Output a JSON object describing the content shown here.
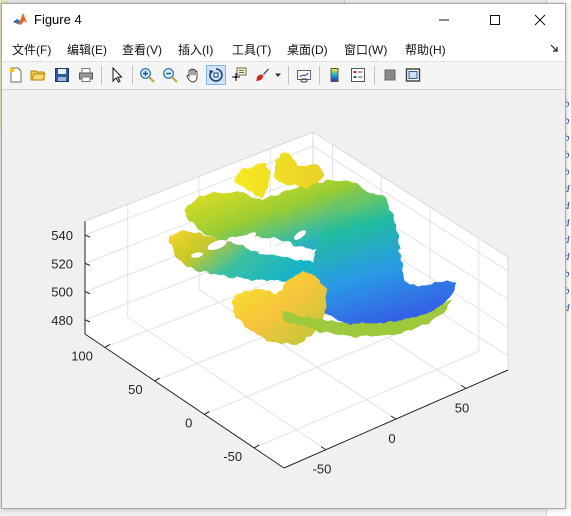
{
  "window": {
    "title": "Figure 4",
    "controls": {
      "minimize": "—",
      "maximize": "☐",
      "close": "✕"
    }
  },
  "menu": [
    {
      "label": "文件(F)"
    },
    {
      "label": "编辑(E)"
    },
    {
      "label": "查看(V)"
    },
    {
      "label": "插入(I)"
    },
    {
      "label": "工具(T)"
    },
    {
      "label": "桌面(D)"
    },
    {
      "label": "窗口(W)"
    },
    {
      "label": "帮助(H)"
    }
  ],
  "toolbar": [
    {
      "icon": "new-figure-icon"
    },
    {
      "icon": "open-file-icon"
    },
    {
      "icon": "save-icon"
    },
    {
      "icon": "print-icon"
    },
    {
      "icon": "edit-plot-arrow-icon"
    },
    {
      "icon": "zoom-in-icon"
    },
    {
      "icon": "zoom-out-icon"
    },
    {
      "icon": "pan-hand-icon"
    },
    {
      "icon": "rotate-3d-icon",
      "active": true
    },
    {
      "icon": "data-cursor-icon"
    },
    {
      "icon": "brush-icon"
    },
    {
      "icon": "link-plot-icon"
    },
    {
      "icon": "colorbar-icon"
    },
    {
      "icon": "legend-icon"
    },
    {
      "icon": "hide-plot-tools-icon"
    },
    {
      "icon": "show-plot-tools-icon"
    }
  ],
  "background_text": [
    "b",
    "b",
    "b",
    "b",
    "b",
    "d",
    "d",
    "d",
    "d",
    "d",
    "b",
    "b",
    "d"
  ],
  "chart_data": {
    "type": "scatter",
    "subtype": "3d-point-cloud",
    "title": "",
    "xlabel": "",
    "ylabel": "",
    "zlabel": "",
    "x_ticks": [
      "-50",
      "0",
      "50"
    ],
    "y_ticks": [
      "100",
      "50",
      "0",
      "-50"
    ],
    "z_ticks": [
      "480",
      "500",
      "520",
      "540"
    ],
    "xlim": [
      -80,
      80
    ],
    "ylim": [
      -80,
      120
    ],
    "zlim": [
      470,
      550
    ],
    "grid": true,
    "colormap": "parula",
    "color_encodes": "z"
  },
  "colors": {
    "accent": "#2b5797",
    "parula_low": "#3e26a8",
    "parula_mid": "#15b2d3",
    "parula_high": "#f9fb15"
  }
}
